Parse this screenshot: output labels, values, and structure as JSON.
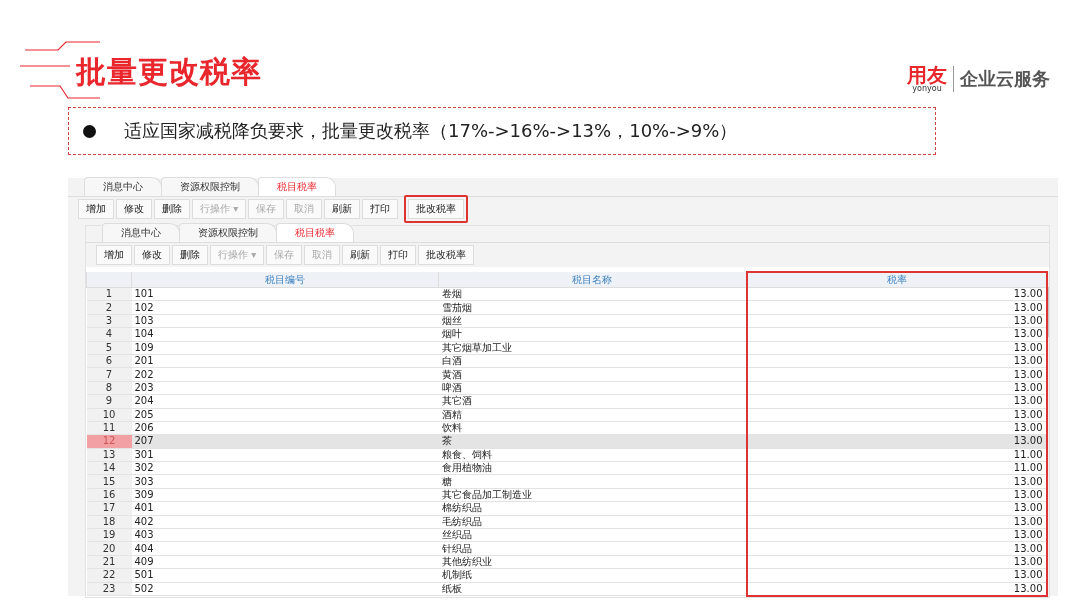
{
  "slide": {
    "title": "批量更改税率",
    "logo": {
      "brand": "用友",
      "sub": "yonyou",
      "tagline": "企业云服务"
    },
    "bullet": "适应国家减税降负要求，批量更改税率（17%->16%->13%，10%->9%）"
  },
  "outer_window": {
    "tabs": [
      {
        "label": "消息中心",
        "selected": false
      },
      {
        "label": "资源权限控制",
        "selected": false
      },
      {
        "label": "税目税率",
        "selected": true
      }
    ],
    "toolbar": [
      {
        "label": "增加",
        "disabled": false,
        "highlighted": false
      },
      {
        "label": "修改",
        "disabled": false,
        "highlighted": false
      },
      {
        "label": "删除",
        "disabled": false,
        "highlighted": false
      },
      {
        "label": "行操作 ▾",
        "disabled": true,
        "highlighted": false
      },
      {
        "label": "保存",
        "disabled": true,
        "highlighted": false
      },
      {
        "label": "取消",
        "disabled": true,
        "highlighted": false
      },
      {
        "label": "刷新",
        "disabled": false,
        "highlighted": false
      },
      {
        "label": "打印",
        "disabled": false,
        "highlighted": false
      },
      {
        "label": "批改税率",
        "disabled": false,
        "highlighted": true
      }
    ]
  },
  "inner_window": {
    "tabs": [
      {
        "label": "消息中心",
        "selected": false
      },
      {
        "label": "资源权限控制",
        "selected": false
      },
      {
        "label": "税目税率",
        "selected": true
      }
    ],
    "toolbar": [
      {
        "label": "增加",
        "disabled": false,
        "highlighted": false
      },
      {
        "label": "修改",
        "disabled": false,
        "highlighted": false
      },
      {
        "label": "删除",
        "disabled": false,
        "highlighted": false
      },
      {
        "label": "行操作 ▾",
        "disabled": true,
        "highlighted": false
      },
      {
        "label": "保存",
        "disabled": true,
        "highlighted": false
      },
      {
        "label": "取消",
        "disabled": true,
        "highlighted": false
      },
      {
        "label": "刷新",
        "disabled": false,
        "highlighted": false
      },
      {
        "label": "打印",
        "disabled": false,
        "highlighted": false
      },
      {
        "label": "批改税率",
        "disabled": false,
        "highlighted": false
      }
    ],
    "table": {
      "columns": [
        {
          "label": "税目编号",
          "highlighted": false
        },
        {
          "label": "税目名称",
          "highlighted": false
        },
        {
          "label": "税率",
          "highlighted": true
        }
      ],
      "rows": [
        {
          "number": "1",
          "code": "101",
          "name": "卷烟",
          "rate": "13.00",
          "selected": false
        },
        {
          "number": "2",
          "code": "102",
          "name": "雪茄烟",
          "rate": "13.00",
          "selected": false
        },
        {
          "number": "3",
          "code": "103",
          "name": "烟丝",
          "rate": "13.00",
          "selected": false
        },
        {
          "number": "4",
          "code": "104",
          "name": "烟叶",
          "rate": "13.00",
          "selected": false
        },
        {
          "number": "5",
          "code": "109",
          "name": "其它烟草加工业",
          "rate": "13.00",
          "selected": false
        },
        {
          "number": "6",
          "code": "201",
          "name": "白酒",
          "rate": "13.00",
          "selected": false
        },
        {
          "number": "7",
          "code": "202",
          "name": "黄酒",
          "rate": "13.00",
          "selected": false
        },
        {
          "number": "8",
          "code": "203",
          "name": "啤酒",
          "rate": "13.00",
          "selected": false
        },
        {
          "number": "9",
          "code": "204",
          "name": "其它酒",
          "rate": "13.00",
          "selected": false
        },
        {
          "number": "10",
          "code": "205",
          "name": "酒精",
          "rate": "13.00",
          "selected": false
        },
        {
          "number": "11",
          "code": "206",
          "name": "饮料",
          "rate": "13.00",
          "selected": false
        },
        {
          "number": "12",
          "code": "207",
          "name": "茶",
          "rate": "13.00",
          "selected": true
        },
        {
          "number": "13",
          "code": "301",
          "name": "粮食、饲料",
          "rate": "11.00",
          "selected": false
        },
        {
          "number": "14",
          "code": "302",
          "name": "食用植物油",
          "rate": "11.00",
          "selected": false
        },
        {
          "number": "15",
          "code": "303",
          "name": "糖",
          "rate": "13.00",
          "selected": false
        },
        {
          "number": "16",
          "code": "309",
          "name": "其它食品加工制造业",
          "rate": "13.00",
          "selected": false
        },
        {
          "number": "17",
          "code": "401",
          "name": "棉纺织品",
          "rate": "13.00",
          "selected": false
        },
        {
          "number": "18",
          "code": "402",
          "name": "毛纺织品",
          "rate": "13.00",
          "selected": false
        },
        {
          "number": "19",
          "code": "403",
          "name": "丝织品",
          "rate": "13.00",
          "selected": false
        },
        {
          "number": "20",
          "code": "404",
          "name": "针织品",
          "rate": "13.00",
          "selected": false
        },
        {
          "number": "21",
          "code": "409",
          "name": "其他纺织业",
          "rate": "13.00",
          "selected": false
        },
        {
          "number": "22",
          "code": "501",
          "name": "机制纸",
          "rate": "13.00",
          "selected": false
        },
        {
          "number": "23",
          "code": "502",
          "name": "纸板",
          "rate": "13.00",
          "selected": false
        }
      ]
    }
  }
}
